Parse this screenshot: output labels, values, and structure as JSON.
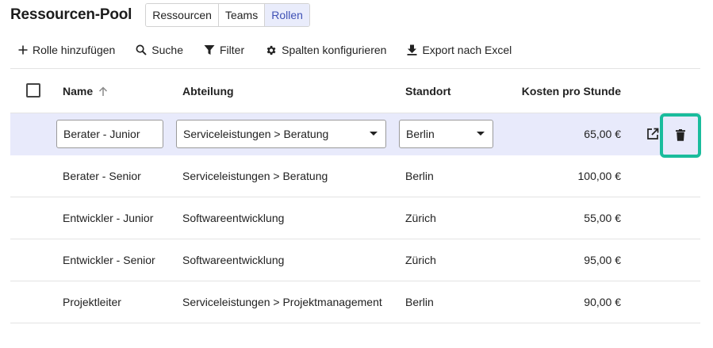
{
  "header": {
    "title": "Ressourcen-Pool",
    "tabs": [
      {
        "label": "Ressourcen",
        "active": false
      },
      {
        "label": "Teams",
        "active": false
      },
      {
        "label": "Rollen",
        "active": true
      }
    ]
  },
  "toolbar": {
    "add_label": "Rolle hinzufügen",
    "search_label": "Suche",
    "filter_label": "Filter",
    "columns_label": "Spalten konfigurieren",
    "export_label": "Export nach Excel"
  },
  "table": {
    "columns": {
      "name": "Name",
      "department": "Abteilung",
      "location": "Standort",
      "cost": "Kosten pro Stunde"
    },
    "sort": {
      "column": "name",
      "direction": "ascending",
      "icon": "arrow-up-icon"
    },
    "edit_row": {
      "name": "Berater - Junior",
      "department": "Serviceleistungen > Beratung",
      "location": "Berlin",
      "cost": "65,00 €"
    },
    "rows": [
      {
        "name": "Berater - Senior",
        "department": "Serviceleistungen > Beratung",
        "location": "Berlin",
        "cost": "100,00 €"
      },
      {
        "name": "Entwickler - Junior",
        "department": "Softwareentwicklung",
        "location": "Zürich",
        "cost": "55,00 €"
      },
      {
        "name": "Entwickler - Senior",
        "department": "Softwareentwicklung",
        "location": "Zürich",
        "cost": "95,00 €"
      },
      {
        "name": "Projektleiter",
        "department": "Serviceleistungen > Projektmanagement",
        "location": "Berlin",
        "cost": "90,00 €"
      }
    ]
  },
  "colors": {
    "accent": "#3f51b5",
    "selected_row": "#e8eafb",
    "focus_ring": "#1abc9c"
  },
  "icons": {
    "add": "plus-icon",
    "search": "search-icon",
    "filter": "filter-icon",
    "columns": "gear-icon",
    "export": "download-icon",
    "open": "open-external-icon",
    "delete": "trash-icon"
  }
}
